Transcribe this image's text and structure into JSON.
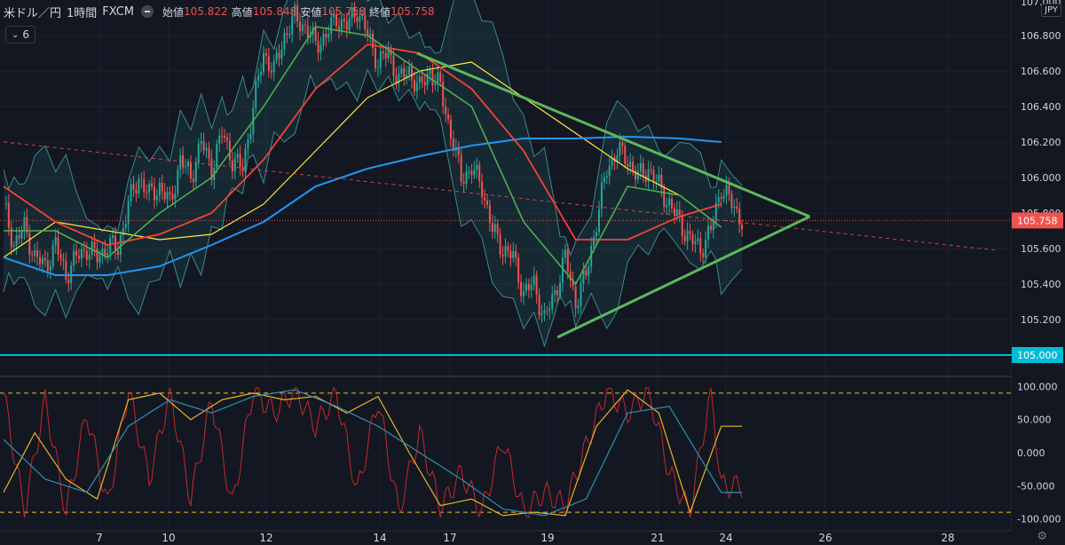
{
  "header": {
    "symbol": "米ドル／円",
    "timeframe": "1時間",
    "source": "FXCM",
    "open_label": "始値",
    "open_value": "105.822",
    "high_label": "高値",
    "high_value": "105.848",
    "low_label": "安値",
    "low_value": "105.758",
    "close_label": "終値",
    "close_value": "105.758",
    "indicator_count": "6",
    "currency": "JPY"
  },
  "colors": {
    "background": "#131722",
    "grid": "#1e222d",
    "candle_up": "#26a69a",
    "candle_down": "#ef5350",
    "ma_short": "#4caf50",
    "ma_mid": "#f44336",
    "ma_long": "#ffeb3b",
    "ma_200": "#2196f3",
    "bollinger": "#3a8a8a",
    "triangle": "#5cb85c",
    "support": "#00bcd4",
    "stoch_k": "#c62828",
    "stoch_d": "#e6b422",
    "stoch_slow": "#2e8fb3"
  },
  "chart_data": [
    {
      "type": "candlestick",
      "symbol": "USD/JPY",
      "x_ticks": [
        "7",
        "10",
        "12",
        "14",
        "17",
        "19",
        "21",
        "24",
        "26",
        "28"
      ],
      "y_ticks": [
        "105.200",
        "105.400",
        "105.600",
        "105.800",
        "106.000",
        "106.200",
        "106.400",
        "106.600",
        "106.800"
      ],
      "y_top_partial": "107.000",
      "ylim": [
        104.9,
        107.0
      ],
      "last_price": "105.758",
      "support_level": "105.000",
      "close_path": [
        [
          0,
          105.85
        ],
        [
          4,
          105.62
        ],
        [
          8,
          105.72
        ],
        [
          12,
          105.55
        ],
        [
          16,
          105.5
        ],
        [
          20,
          105.62
        ],
        [
          24,
          105.45
        ],
        [
          28,
          105.55
        ],
        [
          32,
          105.6
        ],
        [
          36,
          105.55
        ],
        [
          40,
          105.62
        ],
        [
          44,
          105.6
        ],
        [
          48,
          105.85
        ],
        [
          52,
          106.0
        ],
        [
          56,
          105.9
        ],
        [
          60,
          105.95
        ],
        [
          64,
          105.85
        ],
        [
          68,
          106.1
        ],
        [
          72,
          106.0
        ],
        [
          76,
          106.2
        ],
        [
          80,
          106.05
        ],
        [
          84,
          106.25
        ],
        [
          88,
          106.1
        ],
        [
          92,
          106.05
        ],
        [
          96,
          106.4
        ],
        [
          100,
          106.7
        ],
        [
          104,
          106.6
        ],
        [
          108,
          106.8
        ],
        [
          112,
          106.9
        ],
        [
          116,
          106.85
        ],
        [
          120,
          106.75
        ],
        [
          124,
          106.8
        ],
        [
          128,
          106.9
        ],
        [
          132,
          106.85
        ],
        [
          136,
          106.95
        ],
        [
          140,
          106.8
        ],
        [
          144,
          106.65
        ],
        [
          148,
          106.7
        ],
        [
          152,
          106.55
        ],
        [
          156,
          106.6
        ],
        [
          160,
          106.5
        ],
        [
          164,
          106.6
        ],
        [
          168,
          106.5
        ],
        [
          172,
          106.25
        ],
        [
          176,
          106.0
        ],
        [
          180,
          106.05
        ],
        [
          184,
          105.95
        ],
        [
          188,
          105.7
        ],
        [
          192,
          105.6
        ],
        [
          196,
          105.55
        ],
        [
          200,
          105.35
        ],
        [
          204,
          105.4
        ],
        [
          208,
          105.2
        ],
        [
          212,
          105.35
        ],
        [
          216,
          105.55
        ],
        [
          220,
          105.3
        ],
        [
          224,
          105.45
        ],
        [
          228,
          105.75
        ],
        [
          232,
          106.05
        ],
        [
          236,
          106.15
        ],
        [
          240,
          106.1
        ],
        [
          244,
          106.0
        ],
        [
          248,
          106.05
        ],
        [
          252,
          105.95
        ],
        [
          256,
          105.85
        ],
        [
          260,
          105.75
        ],
        [
          264,
          105.65
        ],
        [
          268,
          105.6
        ],
        [
          272,
          105.7
        ],
        [
          276,
          105.95
        ],
        [
          280,
          105.85
        ],
        [
          284,
          105.76
        ]
      ],
      "triangle": {
        "upper": [
          [
            159,
            106.7
          ],
          [
            310,
            105.78
          ]
        ],
        "lower": [
          [
            213,
            105.1
          ],
          [
            310,
            105.78
          ]
        ]
      },
      "trend_dashed": [
        [
          0,
          106.2
        ],
        [
          382,
          105.59
        ]
      ],
      "ma_200": [
        [
          0,
          105.55
        ],
        [
          20,
          105.45
        ],
        [
          40,
          105.45
        ],
        [
          60,
          105.5
        ],
        [
          80,
          105.62
        ],
        [
          100,
          105.75
        ],
        [
          120,
          105.95
        ],
        [
          140,
          106.05
        ],
        [
          160,
          106.12
        ],
        [
          180,
          106.18
        ],
        [
          200,
          106.22
        ],
        [
          220,
          106.22
        ],
        [
          240,
          106.23
        ],
        [
          260,
          106.22
        ],
        [
          276,
          106.2
        ]
      ],
      "ma_long": [
        [
          0,
          105.55
        ],
        [
          20,
          105.75
        ],
        [
          40,
          105.7
        ],
        [
          60,
          105.65
        ],
        [
          80,
          105.68
        ],
        [
          100,
          105.85
        ],
        [
          120,
          106.15
        ],
        [
          140,
          106.45
        ],
        [
          160,
          106.6
        ],
        [
          180,
          106.65
        ],
        [
          200,
          106.45
        ],
        [
          220,
          106.25
        ],
        [
          240,
          106.05
        ],
        [
          260,
          105.9
        ],
        [
          276,
          105.72
        ]
      ],
      "ma_mid": [
        [
          0,
          105.95
        ],
        [
          20,
          105.75
        ],
        [
          40,
          105.62
        ],
        [
          60,
          105.68
        ],
        [
          80,
          105.8
        ],
        [
          100,
          106.1
        ],
        [
          120,
          106.5
        ],
        [
          140,
          106.75
        ],
        [
          160,
          106.7
        ],
        [
          180,
          106.5
        ],
        [
          200,
          106.15
        ],
        [
          220,
          105.65
        ],
        [
          240,
          105.65
        ],
        [
          260,
          105.78
        ],
        [
          276,
          105.85
        ]
      ],
      "ma_short": [
        [
          0,
          105.7
        ],
        [
          20,
          105.7
        ],
        [
          40,
          105.55
        ],
        [
          60,
          105.8
        ],
        [
          80,
          106.0
        ],
        [
          100,
          106.4
        ],
        [
          120,
          106.85
        ],
        [
          140,
          106.8
        ],
        [
          160,
          106.6
        ],
        [
          180,
          106.4
        ],
        [
          200,
          105.75
        ],
        [
          220,
          105.4
        ],
        [
          240,
          105.95
        ],
        [
          260,
          105.9
        ],
        [
          276,
          105.72
        ]
      ]
    },
    {
      "type": "line",
      "indicator": "stochastic",
      "y_ticks": [
        "100.000",
        "50.000",
        "0.000",
        "-50.000",
        "-100.000"
      ],
      "ylim": [
        -110,
        110
      ],
      "overbought": 90,
      "oversold": -90,
      "series": [
        {
          "key": "fast",
          "values": [
            [
              0,
              90
            ],
            [
              8,
              -90
            ],
            [
              16,
              80
            ],
            [
              24,
              -90
            ],
            [
              32,
              60
            ],
            [
              40,
              -80
            ],
            [
              48,
              95
            ],
            [
              56,
              -40
            ],
            [
              64,
              90
            ],
            [
              72,
              -70
            ],
            [
              80,
              80
            ],
            [
              88,
              -80
            ],
            [
              96,
              95
            ],
            [
              104,
              60
            ],
            [
              112,
              95
            ],
            [
              120,
              40
            ],
            [
              128,
              90
            ],
            [
              136,
              -60
            ],
            [
              144,
              80
            ],
            [
              152,
              -90
            ],
            [
              160,
              30
            ],
            [
              168,
              -85
            ],
            [
              176,
              -30
            ],
            [
              184,
              -90
            ],
            [
              192,
              20
            ],
            [
              200,
              -90
            ],
            [
              208,
              -60
            ],
            [
              216,
              -80
            ],
            [
              224,
              10
            ],
            [
              232,
              95
            ],
            [
              240,
              60
            ],
            [
              248,
              95
            ],
            [
              256,
              -30
            ],
            [
              264,
              -90
            ],
            [
              272,
              95
            ],
            [
              276,
              -50
            ]
          ]
        },
        {
          "key": "slow",
          "values": [
            [
              0,
              -60
            ],
            [
              12,
              30
            ],
            [
              24,
              -40
            ],
            [
              36,
              -70
            ],
            [
              48,
              80
            ],
            [
              60,
              90
            ],
            [
              72,
              50
            ],
            [
              84,
              80
            ],
            [
              96,
              90
            ],
            [
              108,
              80
            ],
            [
              120,
              85
            ],
            [
              132,
              60
            ],
            [
              144,
              85
            ],
            [
              156,
              0
            ],
            [
              168,
              -80
            ],
            [
              180,
              -70
            ],
            [
              192,
              -95
            ],
            [
              204,
              -90
            ],
            [
              216,
              -95
            ],
            [
              228,
              40
            ],
            [
              240,
              95
            ],
            [
              252,
              60
            ],
            [
              264,
              -90
            ],
            [
              276,
              40
            ]
          ]
        },
        {
          "key": "signal",
          "values": [
            [
              0,
              20
            ],
            [
              16,
              -40
            ],
            [
              32,
              -60
            ],
            [
              48,
              40
            ],
            [
              64,
              80
            ],
            [
              80,
              60
            ],
            [
              96,
              85
            ],
            [
              112,
              95
            ],
            [
              128,
              70
            ],
            [
              144,
              40
            ],
            [
              160,
              0
            ],
            [
              176,
              -40
            ],
            [
              192,
              -85
            ],
            [
              208,
              -95
            ],
            [
              224,
              -70
            ],
            [
              240,
              60
            ],
            [
              256,
              70
            ],
            [
              276,
              -60
            ]
          ]
        }
      ]
    }
  ]
}
